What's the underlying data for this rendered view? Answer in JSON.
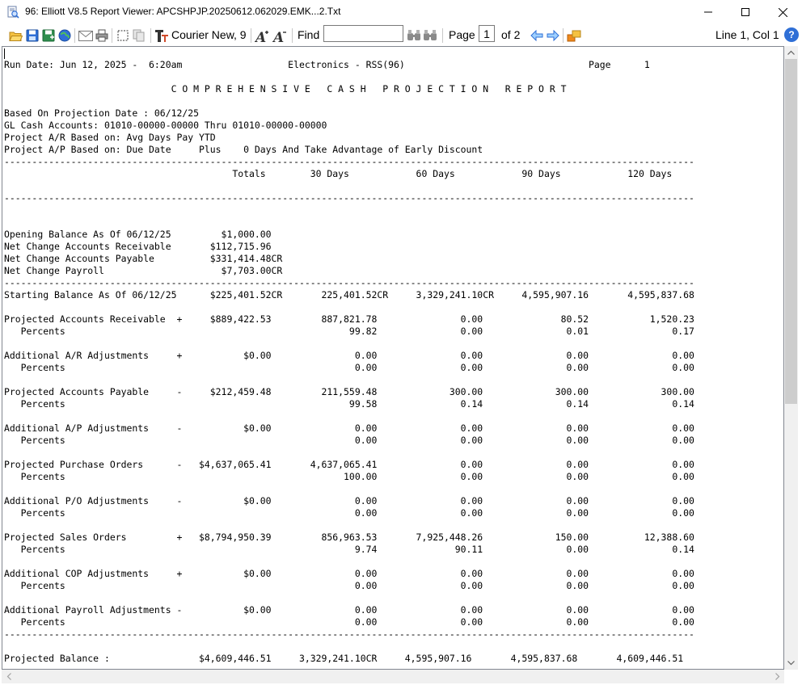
{
  "window": {
    "title": "96: Elliott V8.5 Report Viewer: APCSHPJP.20250612.062029.EMK...2.Txt",
    "minimize_glyph": "—",
    "close_glyph": "✕"
  },
  "toolbar": {
    "font_name": "Courier New, 9",
    "find_label": "Find",
    "find_value": "",
    "page_label": "Page",
    "page_value": "1",
    "page_of": "of 2",
    "status": "Line 1, Col 1",
    "help_glyph": "?"
  },
  "icons": [
    "folder-open-icon",
    "save-icon",
    "save-as-icon",
    "globe-icon",
    "email-icon",
    "print-icon",
    "select-icon",
    "copy-icon",
    "font-icon",
    "font-larger-icon",
    "font-smaller-icon",
    "find-prev-icon",
    "find-next-icon",
    "prev-page-icon",
    "next-page-icon",
    "export-icon",
    "help-icon"
  ],
  "colors": {
    "accent": "#2f6fd6",
    "background": "#ffffff",
    "scrollbar": "#f0f0f0"
  },
  "report": {
    "lines": [
      "Run Date: Jun 12, 2025 -  6:20am                   Electronics - RSS(96)                                 Page      1",
      "",
      "                              C O M P R E H E N S I V E   C A S H   P R O J E C T I O N   R E P O R T",
      "",
      "Based On Projection Date : 06/12/25",
      "GL Cash Accounts: 01010-00000-00000 Thru 01010-00000-00000",
      "Project A/R Based on: Avg Days Pay YTD",
      "Project A/P Based on: Due Date     Plus    0 Days And Take Advantage of Early Discount",
      "----------------------------------------------------------------------------------------------------------------------------",
      "                                         Totals        30 Days            60 Days            90 Days            120 Days",
      "",
      "----------------------------------------------------------------------------------------------------------------------------",
      "",
      "",
      "Opening Balance As Of 06/12/25         $1,000.00",
      "Net Change Accounts Receivable       $112,715.96",
      "Net Change Accounts Payable          $331,414.48CR",
      "Net Change Payroll                     $7,703.00CR",
      "----------------------------------------------------------------------------------------------------------------------------",
      "Starting Balance As Of 06/12/25      $225,401.52CR       225,401.52CR     3,329,241.10CR     4,595,907.16       4,595,837.68",
      "",
      "Projected Accounts Receivable  +     $889,422.53         887,821.78               0.00              80.52           1,520.23",
      "   Percents                                                   99.82               0.00               0.01               0.17",
      "",
      "Additional A/R Adjustments     +           $0.00               0.00               0.00               0.00               0.00",
      "   Percents                                                    0.00               0.00               0.00               0.00",
      "",
      "Projected Accounts Payable     -     $212,459.48         211,559.48             300.00             300.00             300.00",
      "   Percents                                                   99.58               0.14               0.14               0.14",
      "",
      "Additional A/P Adjustments     -           $0.00               0.00               0.00               0.00               0.00",
      "   Percents                                                    0.00               0.00               0.00               0.00",
      "",
      "Projected Purchase Orders      -   $4,637,065.41       4,637,065.41               0.00               0.00               0.00",
      "   Percents                                                  100.00               0.00               0.00               0.00",
      "",
      "Additional P/O Adjustments     -           $0.00               0.00               0.00               0.00               0.00",
      "   Percents                                                    0.00               0.00               0.00               0.00",
      "",
      "Projected Sales Orders         +   $8,794,950.39         856,963.53       7,925,448.26             150.00          12,388.60",
      "   Percents                                                    9.74              90.11               0.00               0.14",
      "",
      "Additional COP Adjustments     +           $0.00               0.00               0.00               0.00               0.00",
      "   Percents                                                    0.00               0.00               0.00               0.00",
      "",
      "Additional Payroll Adjustments -           $0.00               0.00               0.00               0.00               0.00",
      "   Percents                                                    0.00               0.00               0.00               0.00",
      "----------------------------------------------------------------------------------------------------------------------------",
      "",
      "Projected Balance :                $4,609,446.51     3,329,241.10CR     4,595,907.16       4,595,837.68       4,609,446.51",
      "----------------------------------------------------------------------------------------------------------------------------"
    ]
  }
}
